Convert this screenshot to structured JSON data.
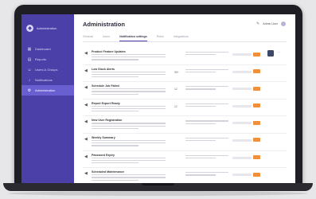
{
  "colors": {
    "sidebar": "#4b3fa8",
    "sidebar_active": "#6a5fd0",
    "accent_badge": "#f0903a"
  },
  "brand": {
    "logo_icon": "app-logo-icon",
    "name": "Administration"
  },
  "sidebar": {
    "items": [
      {
        "icon": "dashboard-icon",
        "label": "Dashboard"
      },
      {
        "icon": "reports-icon",
        "label": "Reports"
      },
      {
        "icon": "users-icon",
        "label": "Users & Groups"
      },
      {
        "icon": "notifications-icon",
        "label": "Notifications"
      },
      {
        "icon": "settings-icon",
        "label": "Administration",
        "active": true
      }
    ]
  },
  "header": {
    "title": "Administration",
    "user_name": "Admin User"
  },
  "tabs": [
    {
      "label": "General"
    },
    {
      "label": "Users"
    },
    {
      "label": "Notification settings",
      "active": true
    },
    {
      "label": "Roles"
    },
    {
      "label": "Integrations"
    }
  ],
  "rows": [
    {
      "icon": "megaphone-icon",
      "title": "Product Feature Updates",
      "count": "",
      "has_action": true
    },
    {
      "icon": "megaphone-icon",
      "title": "Low Stock Alerts",
      "count": "90+",
      "has_action": false
    },
    {
      "icon": "megaphone-icon",
      "title": "Schedule Job Failed",
      "count": "12",
      "has_action": false
    },
    {
      "icon": "megaphone-icon",
      "title": "Report Export Ready",
      "count": "12",
      "has_action": false
    },
    {
      "icon": "megaphone-icon",
      "title": "New User Registration",
      "count": "",
      "has_action": false
    },
    {
      "icon": "megaphone-icon",
      "title": "Weekly Summary",
      "count": "",
      "has_action": false
    },
    {
      "icon": "megaphone-icon",
      "title": "Password Expiry",
      "count": "",
      "has_action": false
    },
    {
      "icon": "megaphone-icon",
      "title": "Scheduled Maintenance",
      "count": "",
      "has_action": false
    }
  ]
}
